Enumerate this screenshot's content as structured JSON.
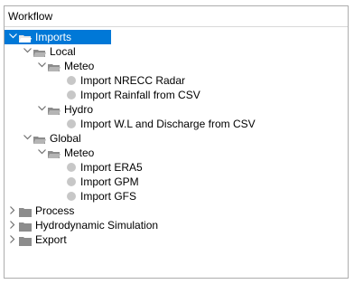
{
  "panel": {
    "title": "Workflow"
  },
  "tree": {
    "imports": "Imports",
    "local": "Local",
    "local_meteo": "Meteo",
    "import_nrecc_radar": "Import NRECC Radar",
    "import_rainfall_csv": "Import Rainfall from CSV",
    "hydro": "Hydro",
    "import_wl_discharge": "Import W.L and Discharge from CSV",
    "global": "Global",
    "global_meteo": "Meteo",
    "import_era5": "Import ERA5",
    "import_gpm": "Import GPM",
    "import_gfs": "Import GFS",
    "process": "Process",
    "hydro_sim": "Hydrodynamic Simulation",
    "export": "Export"
  },
  "colors": {
    "selection": "#0078d7",
    "folder": "#8c8c8c",
    "bullet": "#c7c7c7"
  },
  "icons": {
    "expanded": "chevron-down-icon",
    "collapsed": "chevron-right-icon",
    "open_folder": "folder-open-icon",
    "closed_folder": "folder-icon",
    "item": "circle-icon"
  }
}
